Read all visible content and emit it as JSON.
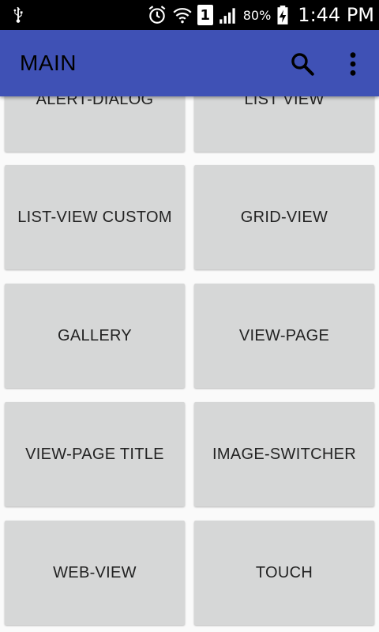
{
  "status_bar": {
    "signal_sim": "1",
    "battery": "80%",
    "time": "1:44 PM"
  },
  "app_bar": {
    "title": "MAIN",
    "color": "#3f51b5",
    "search_icon": "search-icon",
    "menu_icon": "overflow-menu-icon"
  },
  "buttons": [
    {
      "label": "ALERT-DIALOG"
    },
    {
      "label": "LIST VIEW"
    },
    {
      "label": "LIST-VIEW CUSTOM"
    },
    {
      "label": "GRID-VIEW"
    },
    {
      "label": "GALLERY"
    },
    {
      "label": "VIEW-PAGE"
    },
    {
      "label": "VIEW-PAGE TITLE"
    },
    {
      "label": "IMAGE-SWITCHER"
    },
    {
      "label": "WEB-VIEW"
    },
    {
      "label": "TOUCH"
    }
  ]
}
